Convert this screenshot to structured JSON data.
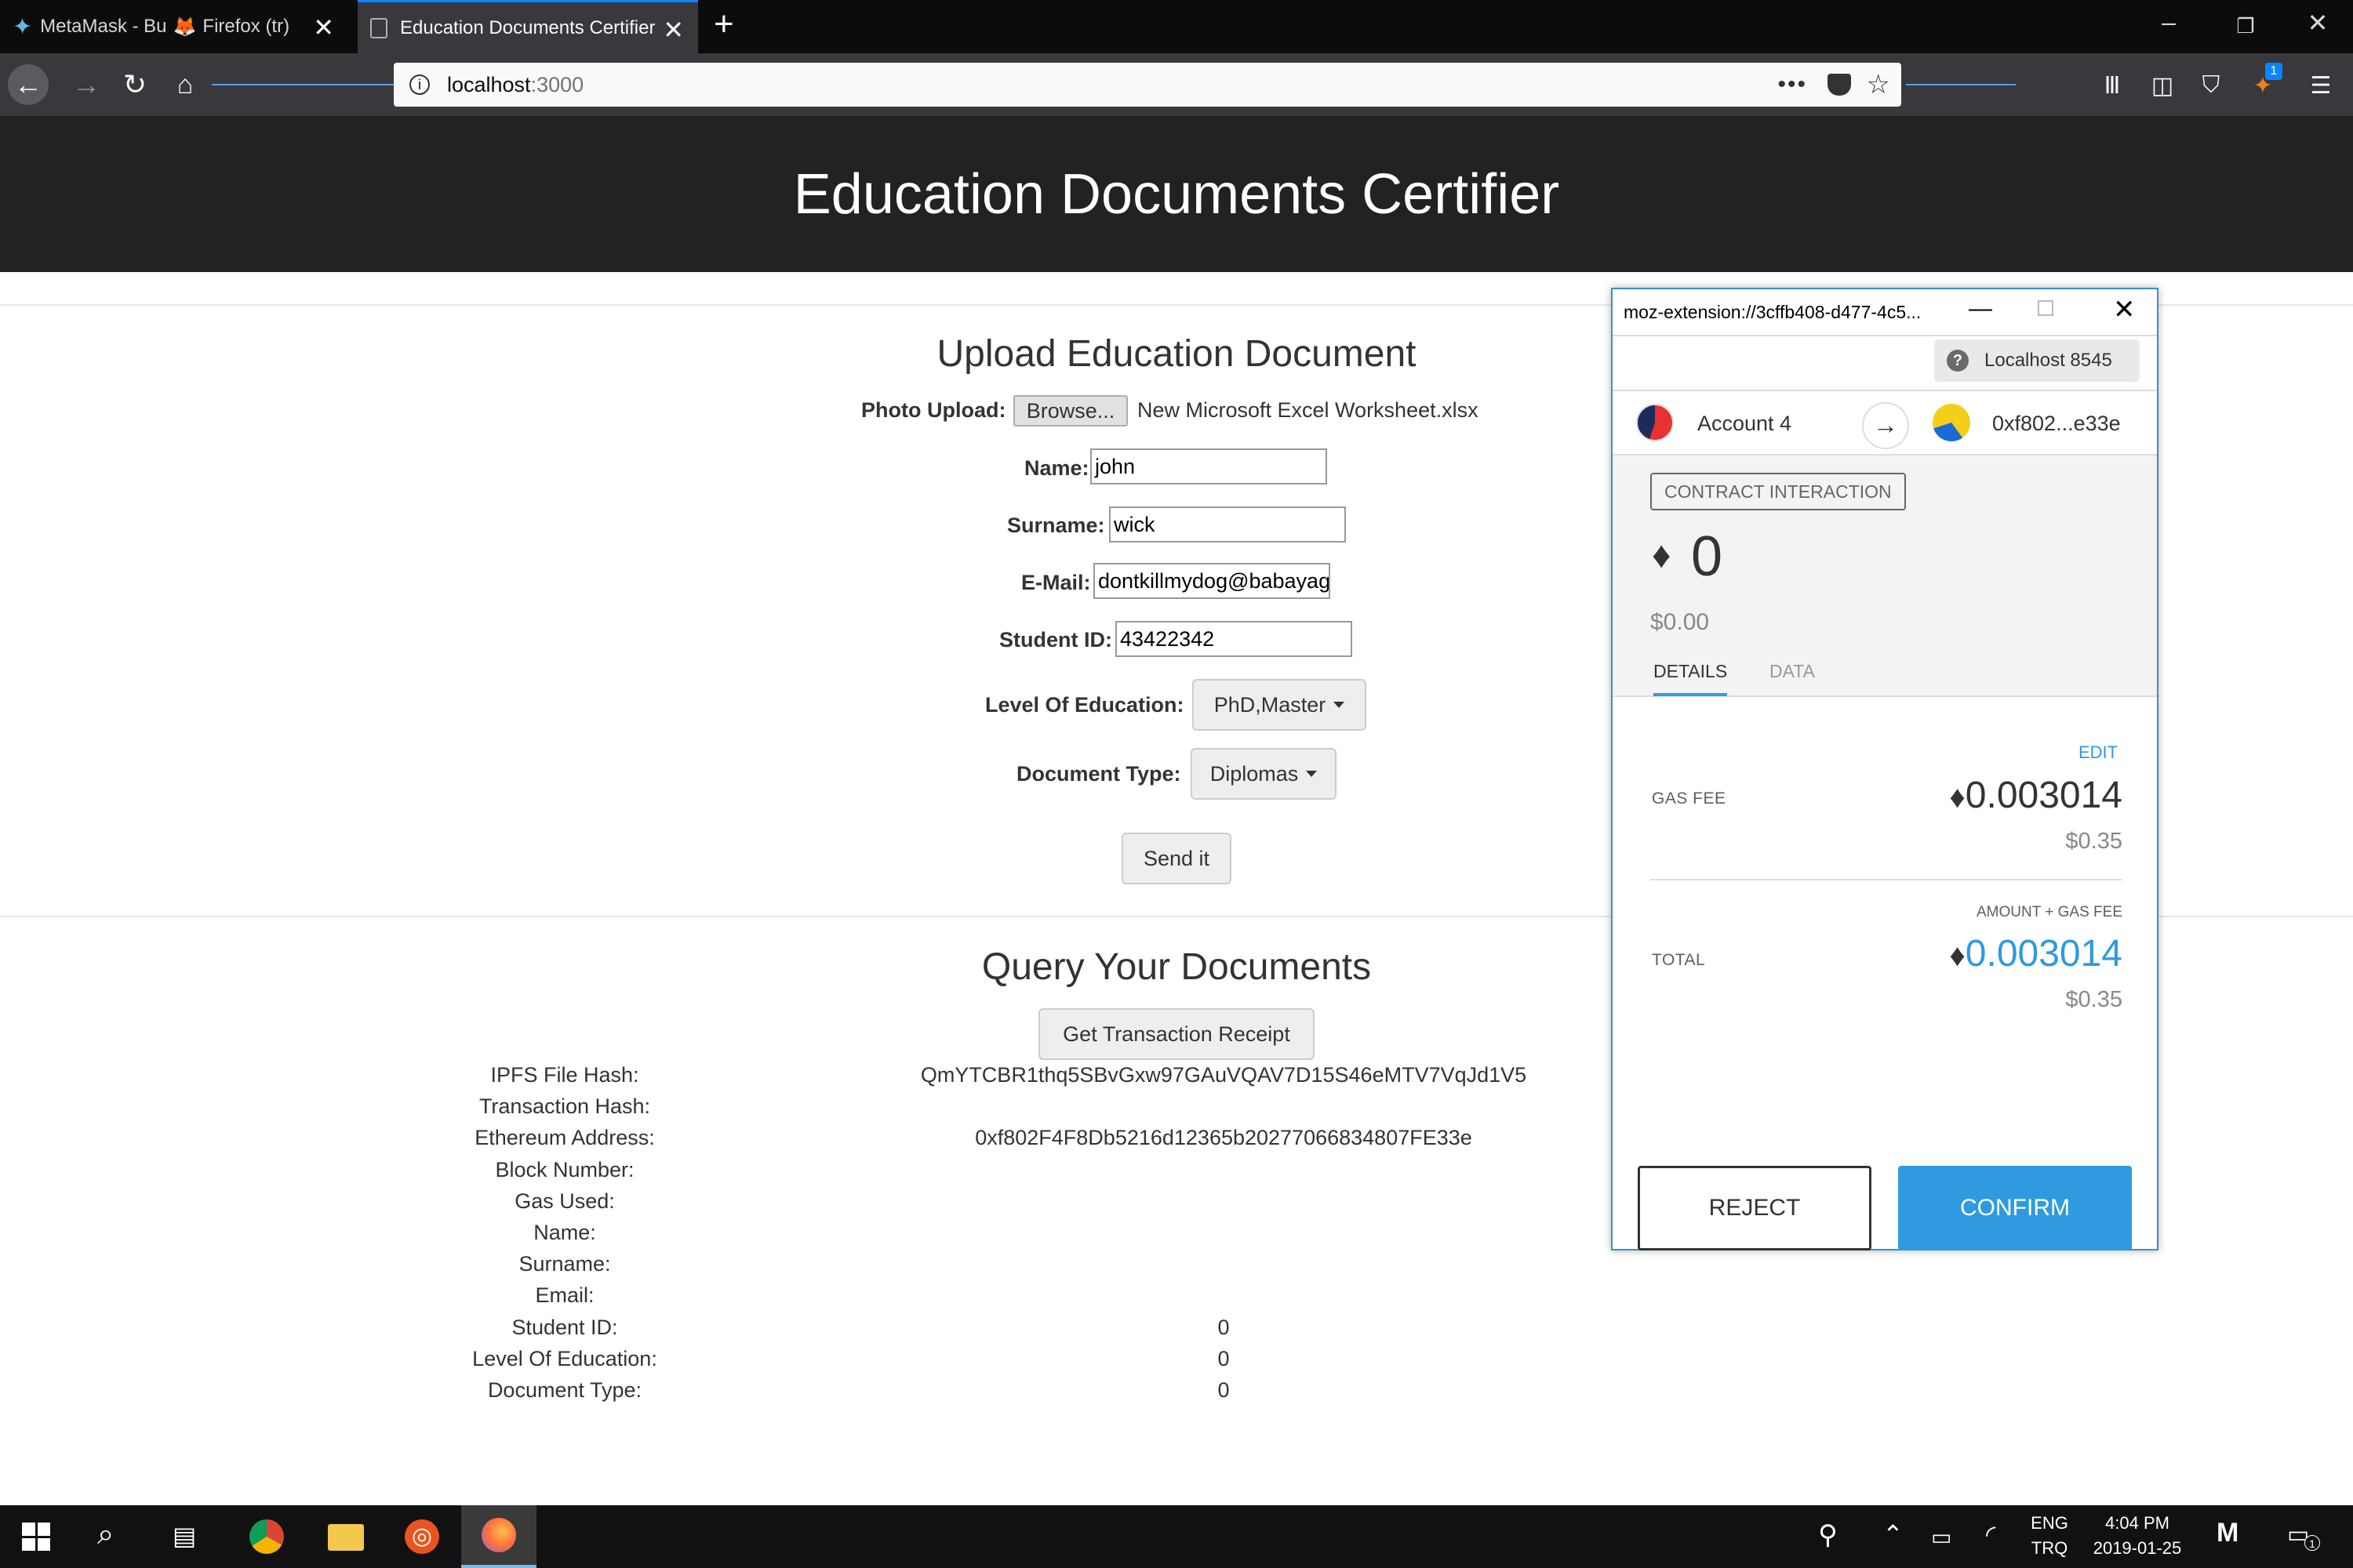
{
  "browser": {
    "tabs": [
      {
        "label": "MetaMask - Bu",
        "extra": "Firefox (tr)",
        "active": false
      },
      {
        "label": "Education Documents Certifier",
        "active": true
      }
    ],
    "url_host": "localhost",
    "url_port": ":3000"
  },
  "page": {
    "header_title": "Education Documents Certifier",
    "upload": {
      "title": "Upload Education Document",
      "photo_label": "Photo Upload:",
      "browse_label": "Browse...",
      "file_name": "New Microsoft Excel Worksheet.xlsx",
      "name_label": "Name:",
      "name_value": "john",
      "surname_label": "Surname:",
      "surname_value": "wick",
      "email_label": "E-Mail:",
      "email_value": "dontkillmydog@babayaga",
      "student_id_label": "Student ID:",
      "student_id_value": "43422342",
      "level_label": "Level Of Education:",
      "level_value": "PhD,Master",
      "doctype_label": "Document Type:",
      "doctype_value": "Diplomas",
      "send_label": "Send it"
    },
    "query": {
      "title": "Query Your Documents",
      "receipt_button": "Get Transaction Receipt",
      "rows": [
        {
          "label": "IPFS File Hash:",
          "value": "QmYTCBR1thq5SBvGxw97GAuVQAV7D15S46eMTV7VqJd1V5"
        },
        {
          "label": "Transaction Hash:",
          "value": ""
        },
        {
          "label": "Ethereum Address:",
          "value": "0xf802F4F8Db5216d12365b20277066834807FE33e"
        },
        {
          "label": "Block Number:",
          "value": ""
        },
        {
          "label": "Gas Used:",
          "value": ""
        },
        {
          "label": "Name:",
          "value": ""
        },
        {
          "label": "Surname:",
          "value": ""
        },
        {
          "label": "Email:",
          "value": ""
        },
        {
          "label": "Student ID:",
          "value": "0"
        },
        {
          "label": "Level Of Education:",
          "value": "0"
        },
        {
          "label": "Document Type:",
          "value": "0"
        }
      ]
    }
  },
  "metamask": {
    "window_title": "moz-extension://3cffb408-d477-4c5...",
    "network": "Localhost 8545",
    "from_account": "Account 4",
    "to_address": "0xf802...e33e",
    "badge": "CONTRACT INTERACTION",
    "amount": "0",
    "amount_usd": "$0.00",
    "tabs": [
      "DETAILS",
      "DATA"
    ],
    "edit_label": "EDIT",
    "gas_fee_label": "GAS FEE",
    "gas_fee_eth": "0.003014",
    "gas_fee_usd": "$0.35",
    "total_caption": "AMOUNT + GAS FEE",
    "total_label": "TOTAL",
    "total_eth": "0.003014",
    "total_usd": "$0.35",
    "reject_label": "REJECT",
    "confirm_label": "CONFIRM",
    "accent_color": "#2f9ae0"
  },
  "taskbar": {
    "lang_top": "ENG",
    "lang_bottom": "TRQ",
    "time": "4:04 PM",
    "date": "2019-01-25",
    "notification_count": "1"
  }
}
